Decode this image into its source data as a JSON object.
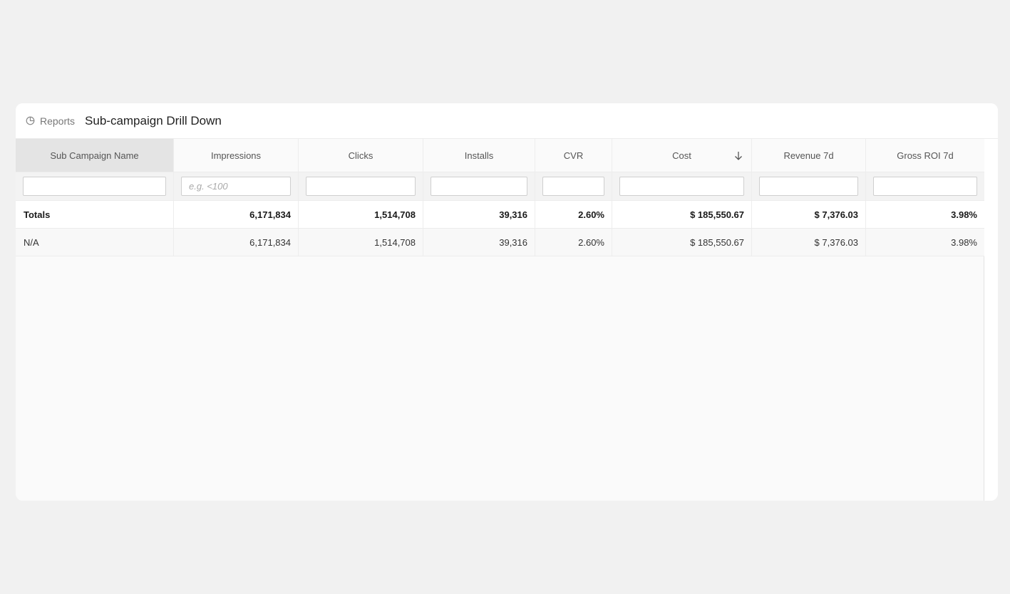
{
  "header": {
    "breadcrumb": "Reports",
    "title": "Sub-campaign Drill Down"
  },
  "icons": {
    "breadcrumb_icon": "pie-chart-icon",
    "sort_icon": "arrow-down-icon"
  },
  "table": {
    "columns": [
      {
        "key": "name",
        "label": "Sub Campaign Name",
        "width": 222
      },
      {
        "key": "impressions",
        "label": "Impressions",
        "width": 175
      },
      {
        "key": "clicks",
        "label": "Clicks",
        "width": 175
      },
      {
        "key": "installs",
        "label": "Installs",
        "width": 157
      },
      {
        "key": "cvr",
        "label": "CVR",
        "width": 108
      },
      {
        "key": "cost",
        "label": "Cost",
        "width": 196
      },
      {
        "key": "revenue",
        "label": "Revenue 7d",
        "width": 160
      },
      {
        "key": "roi",
        "label": "Gross ROI 7d",
        "width": 166
      }
    ],
    "active_column": "name",
    "sorted_column": "cost",
    "sort_direction": "desc",
    "filters": [
      "",
      "",
      "",
      "",
      "",
      "",
      "",
      ""
    ],
    "filter_placeholders": [
      "",
      "e.g. <100",
      "",
      "",
      "",
      "",
      "",
      ""
    ],
    "totals": {
      "name": "Totals",
      "impressions": "6,171,834",
      "clicks": "1,514,708",
      "installs": "39,316",
      "cvr": "2.60%",
      "cost": "$ 185,550.67",
      "revenue": "$ 7,376.03",
      "roi": "3.98%"
    },
    "rows": [
      {
        "name": "N/A",
        "impressions": "6,171,834",
        "clicks": "1,514,708",
        "installs": "39,316",
        "cvr": "2.60%",
        "cost": "$ 185,550.67",
        "revenue": "$ 7,376.03",
        "roi": "3.98%"
      }
    ]
  }
}
